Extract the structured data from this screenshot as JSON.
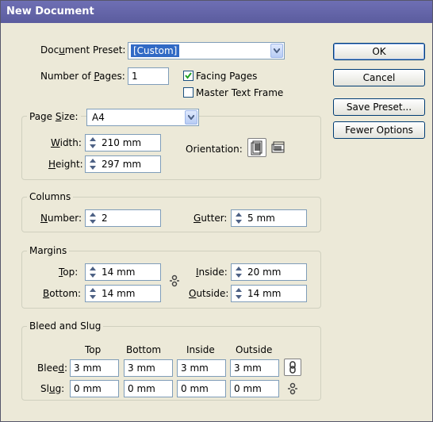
{
  "window": {
    "title": "New Document"
  },
  "document_preset": {
    "label": "Document Preset:",
    "value": "[Custom]"
  },
  "number_of_pages": {
    "label": "Number of Pages:",
    "value": "1"
  },
  "facing_pages": {
    "label": "Facing Pages",
    "checked": true
  },
  "master_text_frame": {
    "label": "Master Text Frame",
    "checked": false
  },
  "page_size": {
    "label": "Page Size:",
    "value": "A4",
    "width_label": "Width:",
    "width_value": "210 mm",
    "height_label": "Height:",
    "height_value": "297 mm",
    "orientation_label": "Orientation:"
  },
  "columns": {
    "title": "Columns",
    "number_label": "Number:",
    "number_value": "2",
    "gutter_label": "Gutter:",
    "gutter_value": "5 mm"
  },
  "margins": {
    "title": "Margins",
    "top_label": "Top:",
    "top_value": "14 mm",
    "bottom_label": "Bottom:",
    "bottom_value": "14 mm",
    "inside_label": "Inside:",
    "inside_value": "20 mm",
    "outside_label": "Outside:",
    "outside_value": "14 mm"
  },
  "bleed_slug": {
    "title": "Bleed and Slug",
    "headers": [
      "Top",
      "Bottom",
      "Inside",
      "Outside"
    ],
    "bleed_label": "Bleed:",
    "bleed_values": [
      "3 mm",
      "3 mm",
      "3 mm",
      "3 mm"
    ],
    "slug_label": "Slug:",
    "slug_values": [
      "0 mm",
      "0 mm",
      "0 mm",
      "0 mm"
    ]
  },
  "buttons": {
    "ok": "OK",
    "cancel": "Cancel",
    "save_preset": "Save Preset...",
    "fewer_options": "Fewer Options"
  }
}
